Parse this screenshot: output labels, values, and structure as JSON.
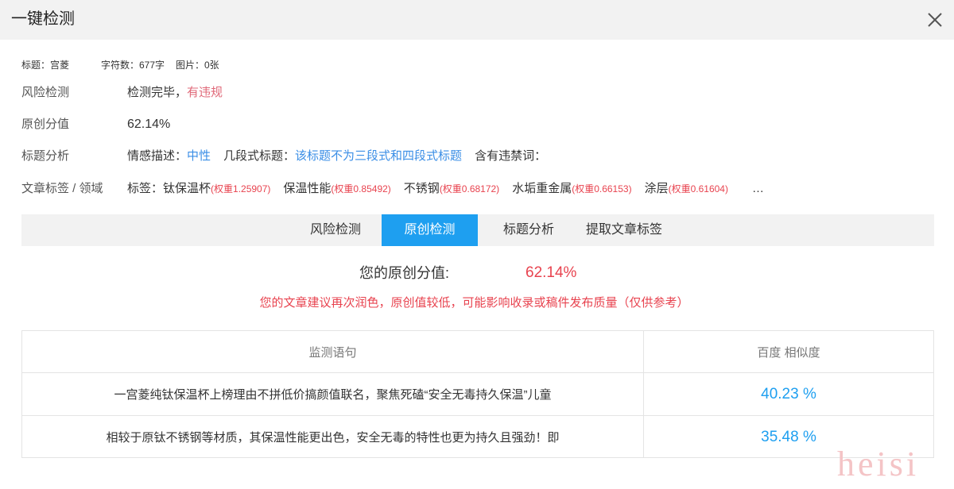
{
  "header": {
    "title": "一键检测",
    "close_icon": "close-icon"
  },
  "meta": {
    "title": "标题：宫菱",
    "chars": "字符数：677字",
    "images": "图片：0张"
  },
  "risk": {
    "label": "风险检测",
    "status": "检测完毕，",
    "result": "有违规"
  },
  "originality": {
    "label": "原创分值",
    "value": "62.14%"
  },
  "title_analysis": {
    "label": "标题分析",
    "emotion_label": "情感描述：",
    "emotion_value": "中性",
    "segment_label": "几段式标题：",
    "segment_value": "该标题不为三段式和四段式标题",
    "forbidden_label": "含有违禁词："
  },
  "tags": {
    "label": "文章标签 / 领域",
    "prefix": "标签：",
    "items": [
      {
        "name": "钛保温杯",
        "weight": "(权重1.25907)"
      },
      {
        "name": "保温性能",
        "weight": "(权重0.85492)"
      },
      {
        "name": "不锈钢",
        "weight": "(权重0.68172)"
      },
      {
        "name": "水垢重金属",
        "weight": "(权重0.66153)"
      },
      {
        "name": "涂层",
        "weight": "(权重0.61604)"
      }
    ],
    "more": "…"
  },
  "tabs": [
    {
      "label": "风险检测",
      "active": false
    },
    {
      "label": "原创检测",
      "active": true
    },
    {
      "label": "标题分析",
      "active": false
    },
    {
      "label": "提取文章标签",
      "active": false
    }
  ],
  "result": {
    "score_label": "您的原创分值:",
    "score_value": "62.14%",
    "advice": "您的文章建议再次润色，原创值较低，可能影响收录或稿件发布质量（仅供参考）"
  },
  "table": {
    "headers": [
      "监测语句",
      "百度 相似度"
    ],
    "rows": [
      {
        "sentence": "一宫菱纯钛保温杯上榜理由不拼低价搞颜值联名，聚焦死磕“安全无毒持久保温”儿童",
        "similarity": "40.23 %"
      },
      {
        "sentence": "相较于原钛不锈钢等材质，其保温性能更出色，安全无毒的特性也更为持久且强劲！即",
        "similarity": "35.48 %"
      }
    ]
  },
  "watermark": "heisi",
  "colors": {
    "accent": "#1e9ff0",
    "warning": "#e8434f",
    "link": "#3a8ee6"
  }
}
